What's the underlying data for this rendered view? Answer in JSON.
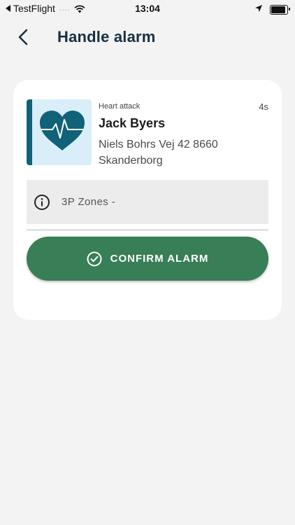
{
  "status_bar": {
    "carrier": "TestFlight",
    "signal_dots": "....",
    "time": "13:04",
    "battery_level": 0.9
  },
  "header": {
    "title": "Handle alarm",
    "back_icon": "chevron-left-icon"
  },
  "alarm": {
    "type": "Heart attack",
    "elapsed": "4s",
    "name": "Jack Byers",
    "address": "Niels Bohrs Vej 42 8660 Skanderborg",
    "thumbnail_icon": "heart-pulse-icon"
  },
  "zones": {
    "icon": "info-icon",
    "label": "3P Zones -"
  },
  "confirm": {
    "icon": "check-circle-icon",
    "label": "CONFIRM ALARM"
  },
  "colors": {
    "accent_teal": "#0f6278",
    "confirm_green": "#387e57",
    "title_navy": "#173040"
  }
}
